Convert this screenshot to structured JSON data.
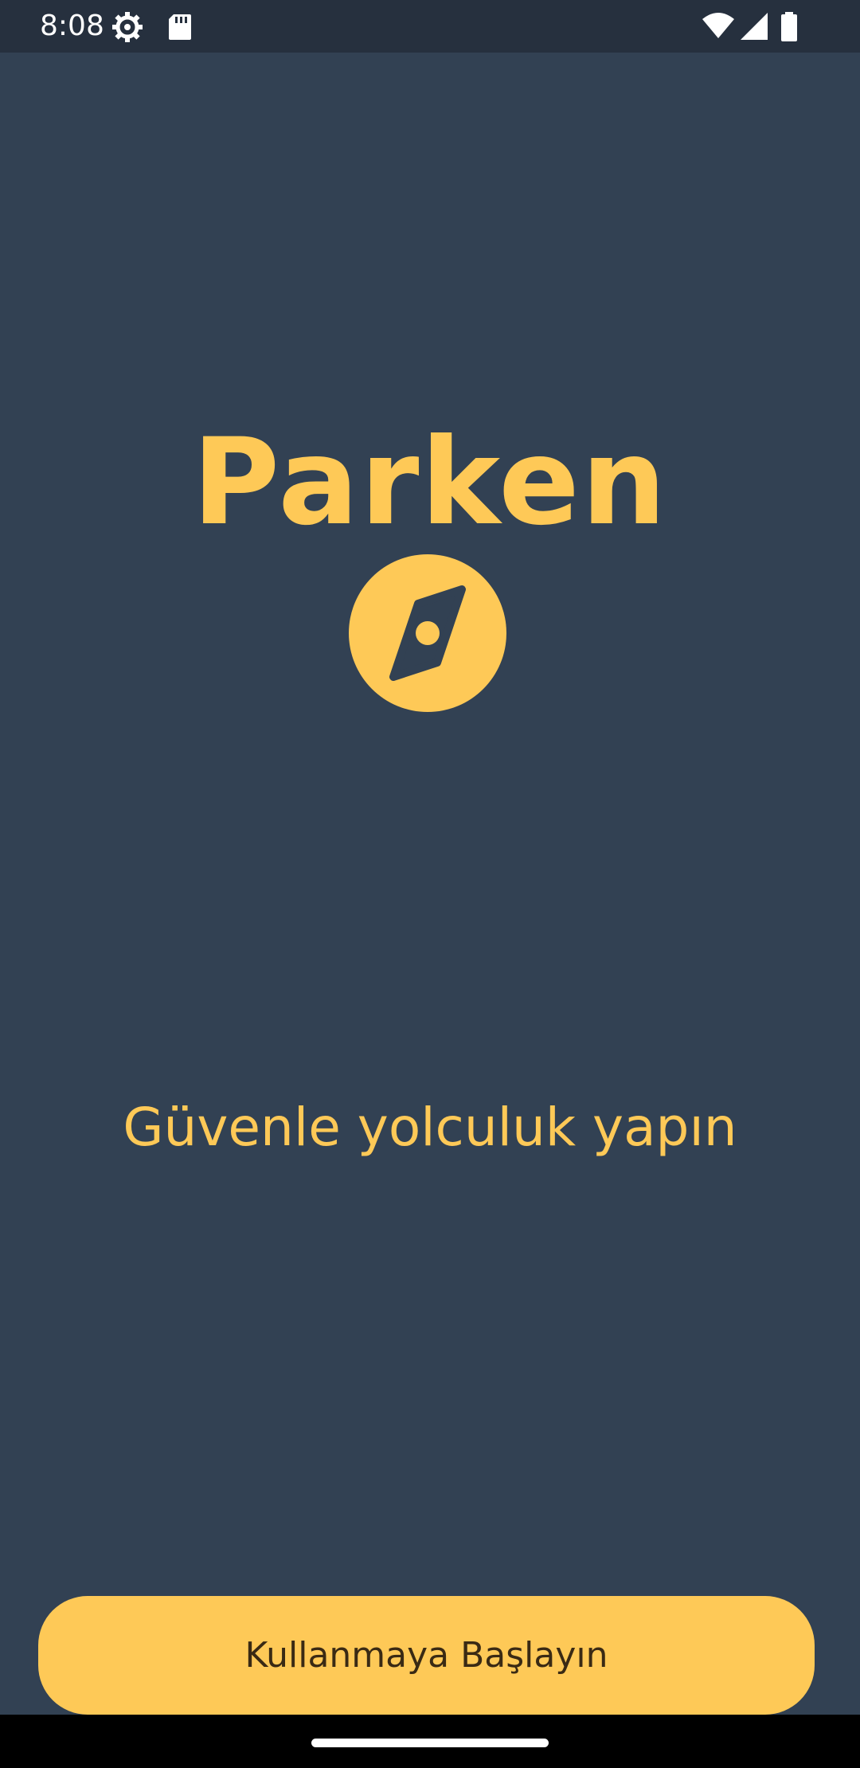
{
  "status_bar": {
    "time": "8:08",
    "icons": [
      "gear-icon",
      "sd-card-icon",
      "wifi-icon",
      "signal-icon",
      "battery-icon"
    ]
  },
  "app": {
    "title": "Parken",
    "logo_icon": "compass-icon",
    "tagline": "Güvenle yolculuk yapın"
  },
  "actions": {
    "start_label": "Kullanmaya Başlayın"
  },
  "colors": {
    "background": "#324153",
    "accent": "#fec957",
    "status_bar": "#26303e",
    "button_text": "#3a2a14"
  }
}
